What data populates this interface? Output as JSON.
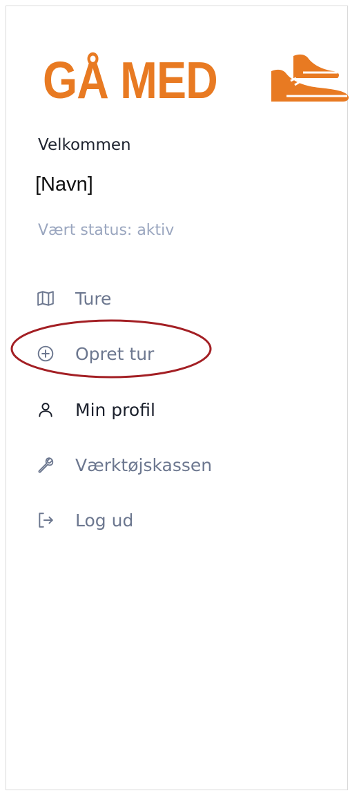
{
  "brand": {
    "logo_text": "GÅ MED",
    "logo_icon": "sneakers-icon",
    "color": "#e87a22"
  },
  "user": {
    "welcome": "Velkommen",
    "name": "[Navn]",
    "status": "Vært status: aktiv"
  },
  "nav": {
    "items": [
      {
        "label": "Ture",
        "icon": "map-icon"
      },
      {
        "label": "Opret tur",
        "icon": "plus-circle-icon"
      },
      {
        "label": "Min profil",
        "icon": "user-icon"
      },
      {
        "label": "Værktøjskassen",
        "icon": "wrench-icon"
      },
      {
        "label": "Log ud",
        "icon": "logout-icon"
      }
    ]
  },
  "colors": {
    "muted_text": "#6c778f",
    "dark_text": "#1a1f2b",
    "status_text": "#9aa6bf",
    "highlight_ellipse": "#a31f24"
  }
}
